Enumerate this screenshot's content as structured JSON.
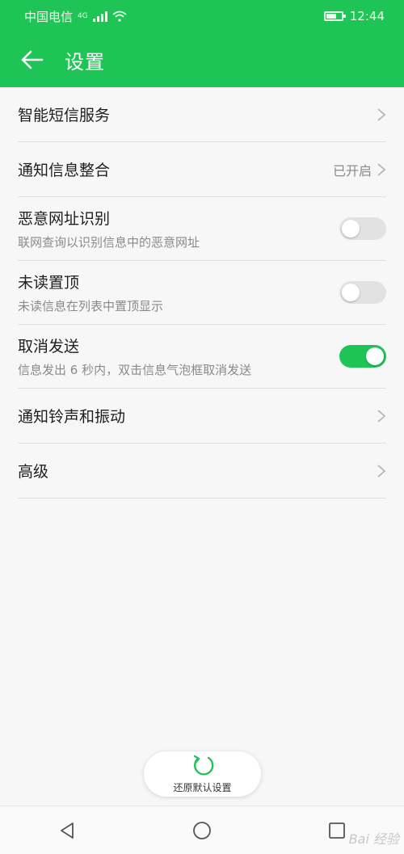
{
  "status_bar": {
    "carrier": "中国电信",
    "network_badge": "4G",
    "time": "12:44",
    "battery_level": 0.6
  },
  "header": {
    "back_icon": "arrow-left-icon",
    "title": "设置"
  },
  "settings": [
    {
      "title": "智能短信服务",
      "subtitle": "",
      "value": "",
      "control": "chevron"
    },
    {
      "title": "通知信息整合",
      "subtitle": "",
      "value": "已开启",
      "control": "chevron"
    },
    {
      "title": "恶意网址识别",
      "subtitle": "联网查询以识别信息中的恶意网址",
      "value": "",
      "control": "toggle",
      "toggle_on": false
    },
    {
      "title": "未读置顶",
      "subtitle": "未读信息在列表中置顶显示",
      "value": "",
      "control": "toggle",
      "toggle_on": false
    },
    {
      "title": "取消发送",
      "subtitle": "信息发出 6 秒内，双击信息气泡框取消发送",
      "value": "",
      "control": "toggle",
      "toggle_on": true
    },
    {
      "title": "通知铃声和振动",
      "subtitle": "",
      "value": "",
      "control": "chevron"
    },
    {
      "title": "高级",
      "subtitle": "",
      "value": "",
      "control": "chevron"
    }
  ],
  "reset": {
    "label": "还原默认设置",
    "icon": "refresh-icon"
  },
  "navbar": {
    "back": "nav-back-icon",
    "home": "nav-home-icon",
    "recent": "nav-recent-icon"
  },
  "watermark": "Bai 经验",
  "colors": {
    "accent": "#1ec455",
    "toggle_off": "#e2e2e2"
  }
}
